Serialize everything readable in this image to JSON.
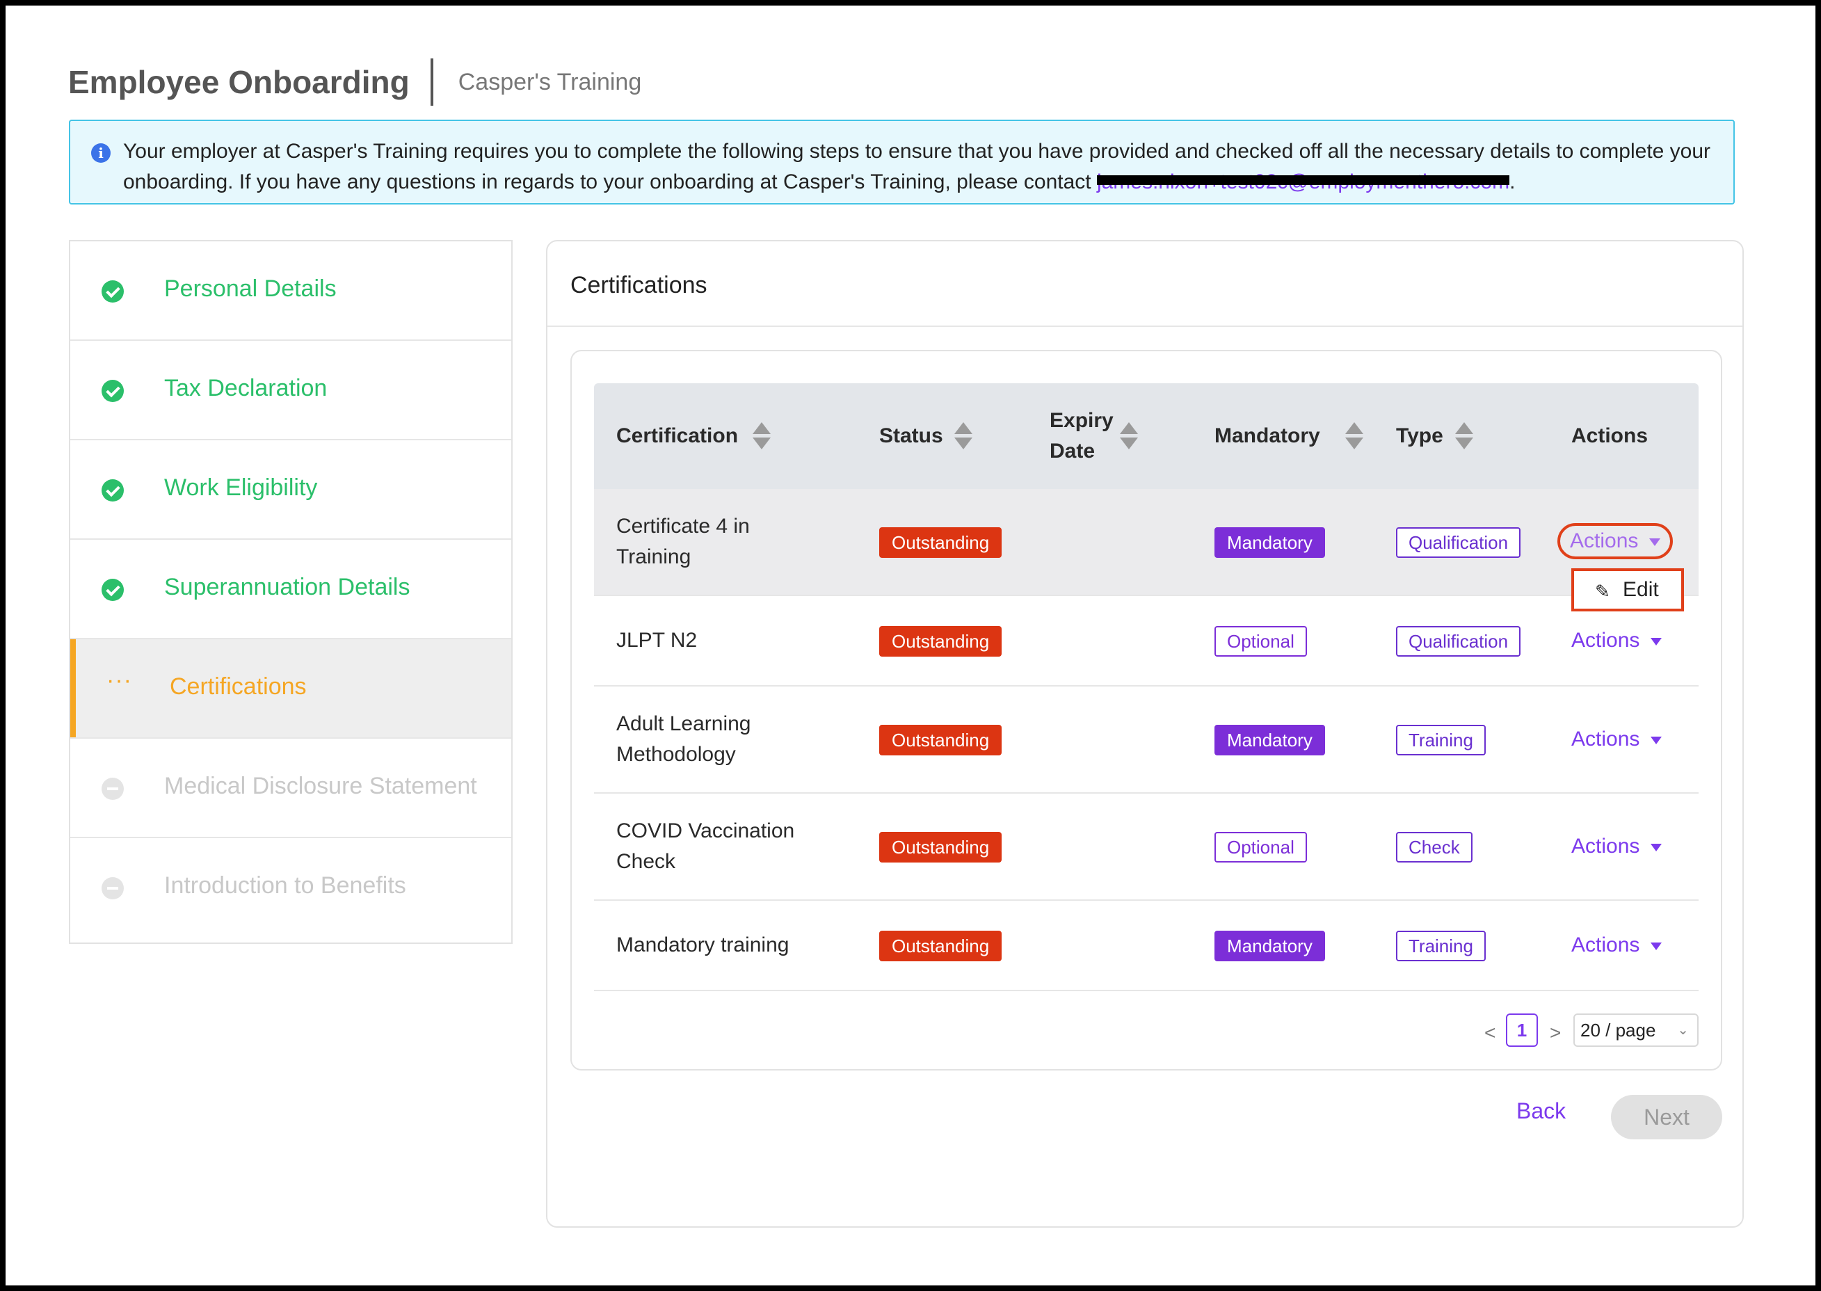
{
  "header": {
    "title": "Employee Onboarding",
    "subtitle": "Casper's Training"
  },
  "banner": {
    "icon": "info-icon",
    "text_before": "Your employer at Casper's Training requires you to complete the following steps to ensure that you have provided and checked off all the necessary details to complete your onboarding. If you have any questions in regards to your onboarding at Casper's Training, please contact ",
    "email": "james.nixon+test02c@employmenthero.com",
    "text_after": "."
  },
  "steps": [
    {
      "label": "Personal Details",
      "state": "done"
    },
    {
      "label": "Tax Declaration",
      "state": "done"
    },
    {
      "label": "Work Eligibility",
      "state": "done"
    },
    {
      "label": "Superannuation Details",
      "state": "done"
    },
    {
      "label": "Certifications",
      "state": "active"
    },
    {
      "label": "Medical Disclosure Statement",
      "state": "todo"
    },
    {
      "label": "Introduction to Benefits",
      "state": "todo"
    }
  ],
  "card": {
    "title": "Certifications"
  },
  "table": {
    "columns": {
      "certification": "Certification",
      "status": "Status",
      "expiry_date": "Expiry Date",
      "mandatory": "Mandatory",
      "type": "Type",
      "actions": "Actions"
    },
    "rows": [
      {
        "certification": "Certificate 4 in Training",
        "status": "Outstanding",
        "expiry_date": "",
        "mandatory": "Mandatory",
        "type": "Qualification",
        "actions": "Actions"
      },
      {
        "certification": "JLPT N2",
        "status": "Outstanding",
        "expiry_date": "",
        "mandatory": "Optional",
        "type": "Qualification",
        "actions": "Actions"
      },
      {
        "certification": "Adult Learning Methodology",
        "status": "Outstanding",
        "expiry_date": "",
        "mandatory": "Mandatory",
        "type": "Training",
        "actions": "Actions"
      },
      {
        "certification": "COVID Vaccination Check",
        "status": "Outstanding",
        "expiry_date": "",
        "mandatory": "Optional",
        "type": "Check",
        "actions": "Actions"
      },
      {
        "certification": "Mandatory training",
        "status": "Outstanding",
        "expiry_date": "",
        "mandatory": "Mandatory",
        "type": "Training",
        "actions": "Actions"
      }
    ],
    "actions_menu": {
      "edit_label": "Edit",
      "edit_icon": "pencil-icon"
    }
  },
  "pagination": {
    "prev": "<",
    "current_page": "1",
    "next": ">",
    "page_size": "20 / page"
  },
  "footer": {
    "back_label": "Back",
    "next_label": "Next"
  },
  "colors": {
    "accent": "#7c3aed",
    "done": "#2bbf6a",
    "active": "#f5a623",
    "outstanding": "#dc3512",
    "banner_border": "#44c4e6"
  }
}
